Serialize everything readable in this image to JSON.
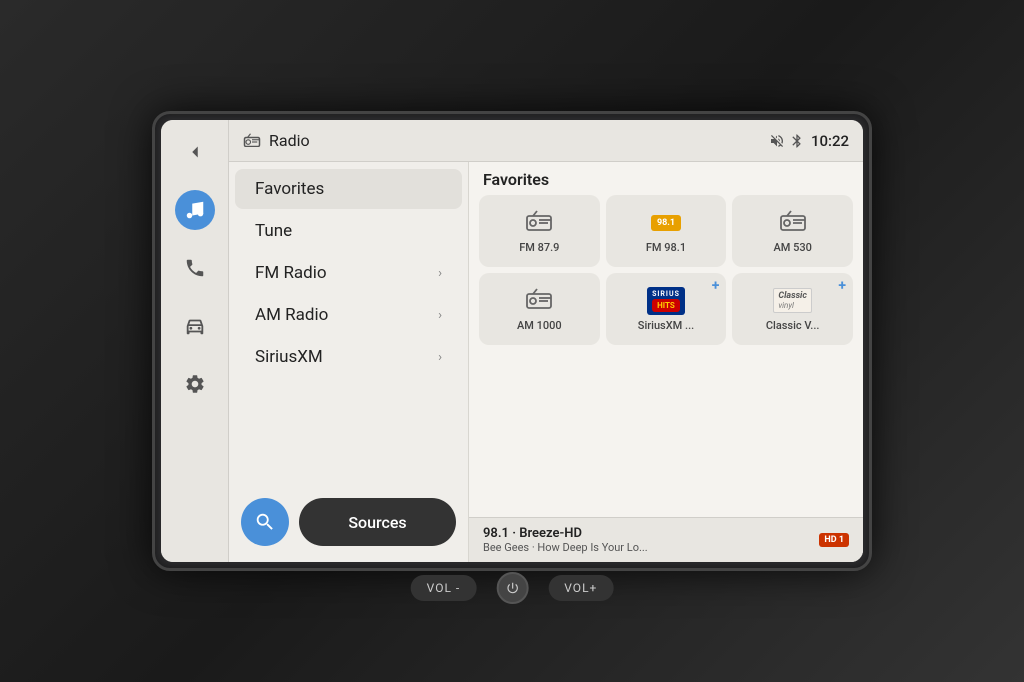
{
  "screen": {
    "title": "Radio",
    "time": "10:22"
  },
  "sidebar": {
    "icons": [
      {
        "name": "back-icon",
        "symbol": "◄"
      },
      {
        "name": "music-icon",
        "symbol": "♪",
        "active": true
      },
      {
        "name": "phone-icon",
        "symbol": "✆"
      },
      {
        "name": "car-icon",
        "symbol": "🚗"
      },
      {
        "name": "settings-icon",
        "symbol": "⚙"
      }
    ]
  },
  "menu": {
    "items": [
      {
        "label": "Favorites",
        "hasChevron": false,
        "active": true
      },
      {
        "label": "Tune",
        "hasChevron": false
      },
      {
        "label": "FM Radio",
        "hasChevron": true
      },
      {
        "label": "AM Radio",
        "hasChevron": true
      },
      {
        "label": "SiriusXM",
        "hasChevron": true
      }
    ],
    "search_label": "🔍",
    "sources_label": "Sources"
  },
  "favorites": {
    "title": "Favorites",
    "tiles": [
      {
        "id": "fm879",
        "label": "FM 87.9",
        "type": "radio",
        "hasAdd": false
      },
      {
        "id": "fm981",
        "label": "FM 98.1",
        "type": "logo-fm981",
        "hasAdd": false
      },
      {
        "id": "am530",
        "label": "AM 530",
        "type": "radio",
        "hasAdd": false
      },
      {
        "id": "am1000",
        "label": "AM 1000",
        "type": "radio",
        "hasAdd": false
      },
      {
        "id": "siriushits",
        "label": "SiriusXM ...",
        "type": "logo-hits",
        "hasAdd": true
      },
      {
        "id": "classicvinyl",
        "label": "Classic V...",
        "type": "logo-vinyl",
        "hasAdd": true
      }
    ]
  },
  "now_playing": {
    "station": "98.1 · Breeze-HD",
    "song": "Bee Gees · How Deep Is Your Lo...",
    "badge": "HD 1"
  },
  "bottom_controls": {
    "vol_minus": "VOL -",
    "power": "⏻",
    "vol_plus": "VOL+"
  }
}
